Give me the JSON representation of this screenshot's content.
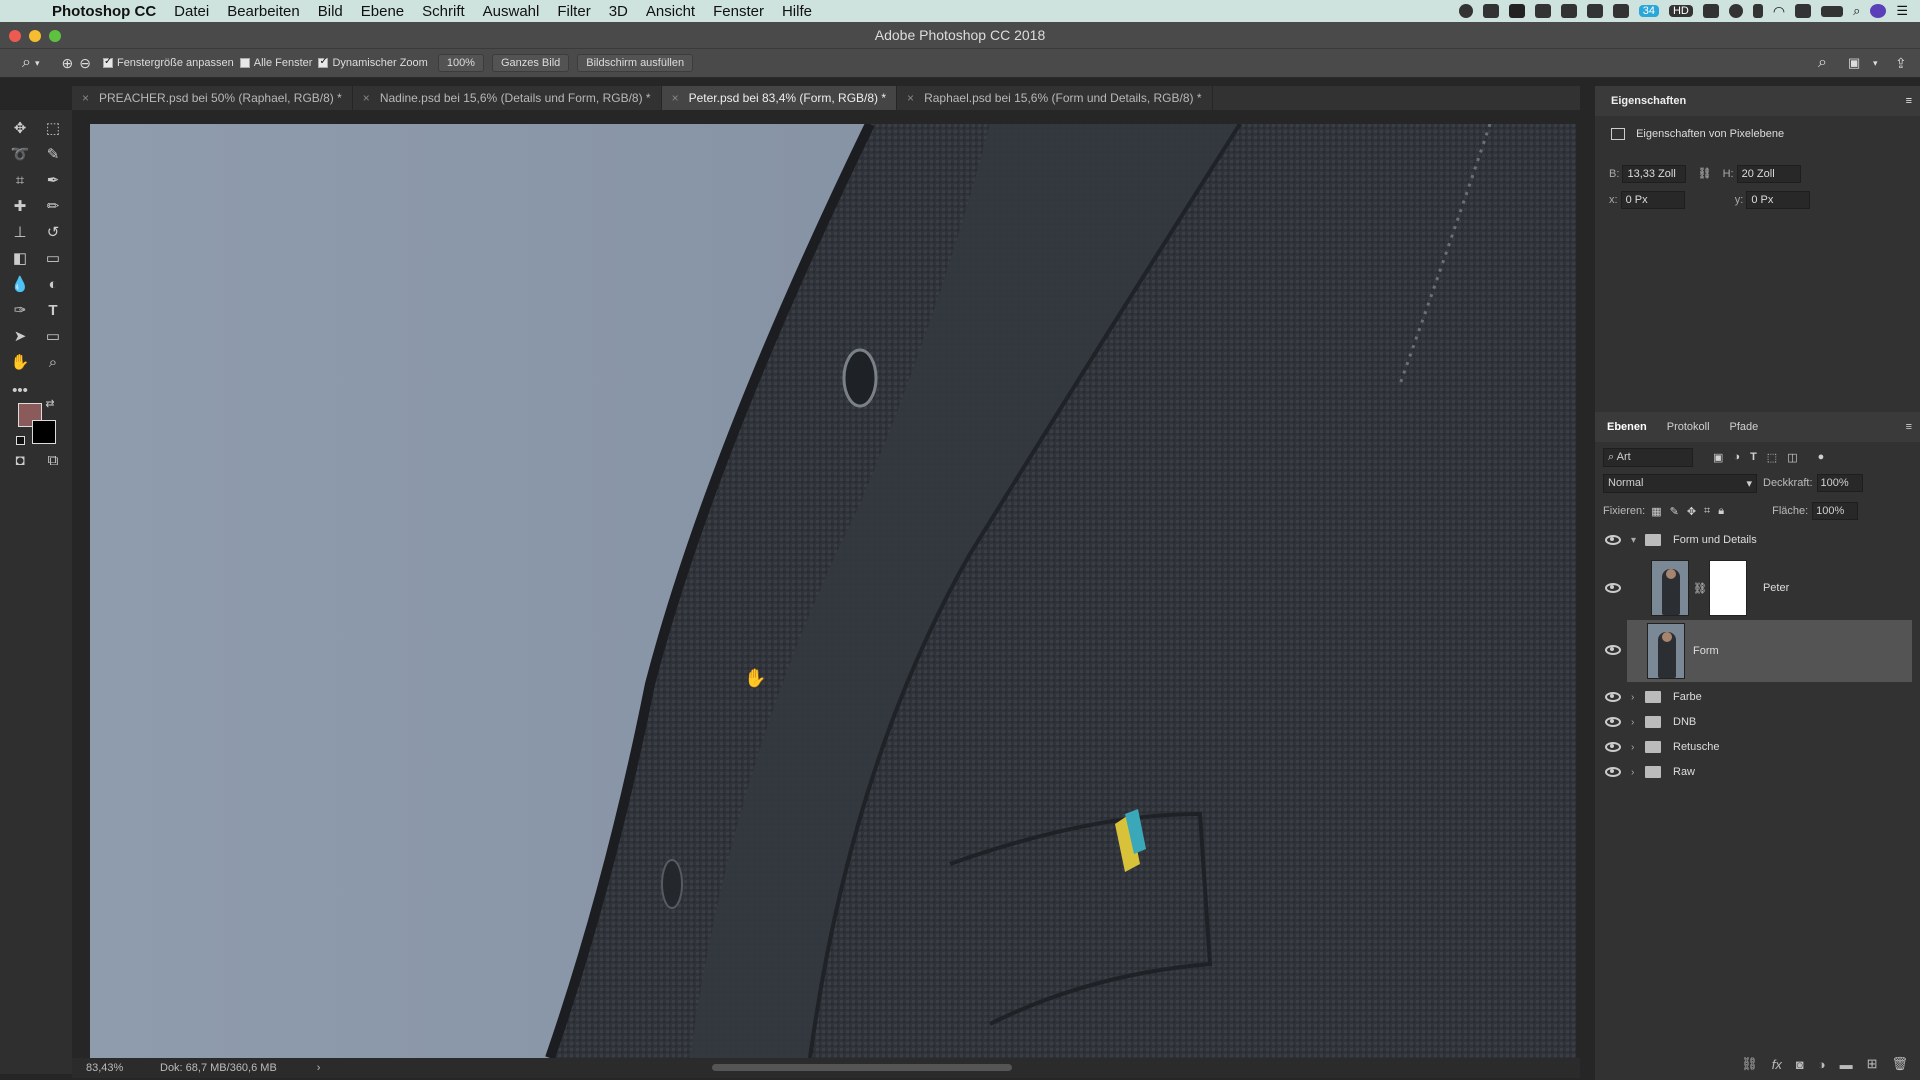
{
  "menubar": {
    "app_name": "Photoshop CC",
    "items": [
      "Datei",
      "Bearbeiten",
      "Bild",
      "Ebene",
      "Schrift",
      "Auswahl",
      "Filter",
      "3D",
      "Ansicht",
      "Fenster",
      "Hilfe"
    ],
    "battery_badge": "34",
    "status_badge": "HD"
  },
  "window": {
    "title": "Adobe Photoshop CC 2018"
  },
  "options": {
    "fit_window": "Fenstergröße anpassen",
    "all_windows": "Alle Fenster",
    "dynamic_zoom": "Dynamischer Zoom",
    "zoom_value": "100%",
    "whole_image": "Ganzes Bild",
    "fill_screen": "Bildschirm ausfüllen"
  },
  "tabs": [
    {
      "label": "PREACHER.psd bei 50% (Raphael, RGB/8) *"
    },
    {
      "label": "Nadine.psd bei 15,6% (Details und Form, RGB/8) *"
    },
    {
      "label": "Peter.psd bei 83,4% (Form, RGB/8) *"
    },
    {
      "label": "Raphael.psd bei 15,6% (Form und Details, RGB/8) *"
    }
  ],
  "status": {
    "zoom": "83,43%",
    "doc": "Dok: 68,7 MB/360,6 MB"
  },
  "properties": {
    "header": "Eigenschaften",
    "subtitle": "Eigenschaften von Pixelebene",
    "w_label": "B:",
    "w_value": "13,33 Zoll",
    "h_label": "H:",
    "h_value": "20 Zoll",
    "x_label": "x:",
    "x_value": "0 Px",
    "y_label": "y:",
    "y_value": "0 Px"
  },
  "layers_panel": {
    "tabs": [
      "Ebenen",
      "Protokoll",
      "Pfade"
    ],
    "filter_label": "Art",
    "blend_mode": "Normal",
    "opacity_label": "Deckkraft:",
    "opacity_value": "100%",
    "lock_label": "Fixieren:",
    "fill_label": "Fläche:",
    "fill_value": "100%",
    "layers": [
      {
        "name": "Form und Details",
        "kind": "group-open"
      },
      {
        "name": "Peter",
        "kind": "pixel-mask"
      },
      {
        "name": "Form",
        "kind": "pixel",
        "selected": true
      },
      {
        "name": "Farbe",
        "kind": "group"
      },
      {
        "name": "DNB",
        "kind": "group"
      },
      {
        "name": "Retusche",
        "kind": "group"
      },
      {
        "name": "Raw",
        "kind": "group"
      }
    ]
  },
  "colors": {
    "foreground": "#8b5a5a",
    "background": "#000000",
    "canvas_bg": "#8d9aad",
    "jacket": "#2f3338"
  }
}
